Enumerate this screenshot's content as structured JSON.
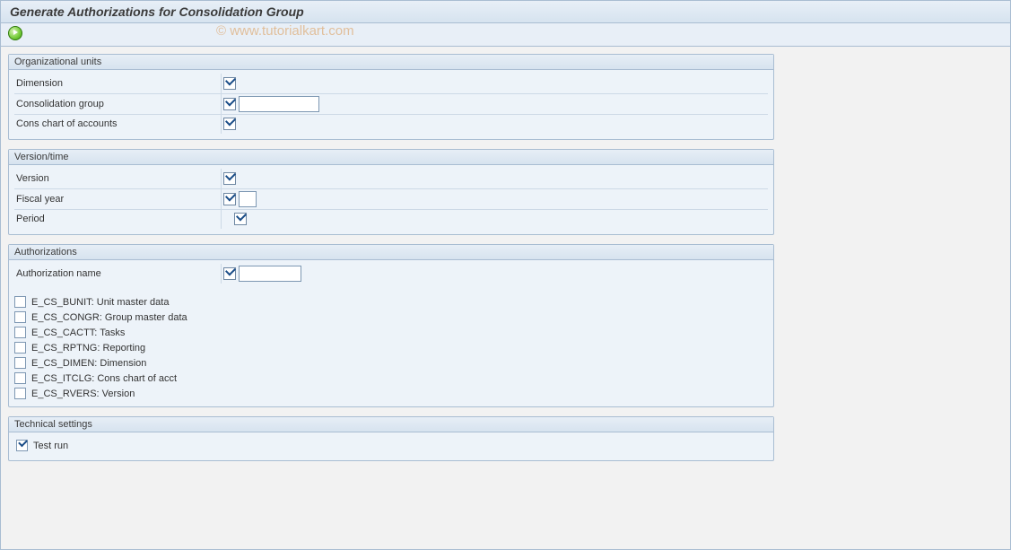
{
  "title": "Generate Authorizations for Consolidation Group",
  "watermark": "© www.tutorialkart.com",
  "groups": {
    "org": {
      "title": "Organizational units",
      "fields": {
        "dimension": {
          "label": "Dimension",
          "checked": true,
          "value": ""
        },
        "cons_group": {
          "label": "Consolidation group",
          "checked": true,
          "value": ""
        },
        "cons_chart": {
          "label": "Cons chart of accounts",
          "checked": true,
          "value": ""
        }
      }
    },
    "vt": {
      "title": "Version/time",
      "fields": {
        "version": {
          "label": "Version",
          "checked": true,
          "value": ""
        },
        "fiscal_year": {
          "label": "Fiscal year",
          "checked": true,
          "value": ""
        },
        "period": {
          "label": "Period",
          "checked": true,
          "value": ""
        }
      }
    },
    "auth": {
      "title": "Authorizations",
      "name_label": "Authorization name",
      "name_checked": true,
      "name_value": "",
      "objects": [
        {
          "label": "E_CS_BUNIT: Unit master data",
          "checked": false
        },
        {
          "label": "E_CS_CONGR: Group master data",
          "checked": false
        },
        {
          "label": "E_CS_CACTT: Tasks",
          "checked": false
        },
        {
          "label": "E_CS_RPTNG: Reporting",
          "checked": false
        },
        {
          "label": "E_CS_DIMEN: Dimension",
          "checked": false
        },
        {
          "label": "E_CS_ITCLG: Cons chart of acct",
          "checked": false
        },
        {
          "label": "E_CS_RVERS: Version",
          "checked": false
        }
      ]
    },
    "tech": {
      "title": "Technical settings",
      "test_run": {
        "label": "Test run",
        "checked": true
      }
    }
  }
}
